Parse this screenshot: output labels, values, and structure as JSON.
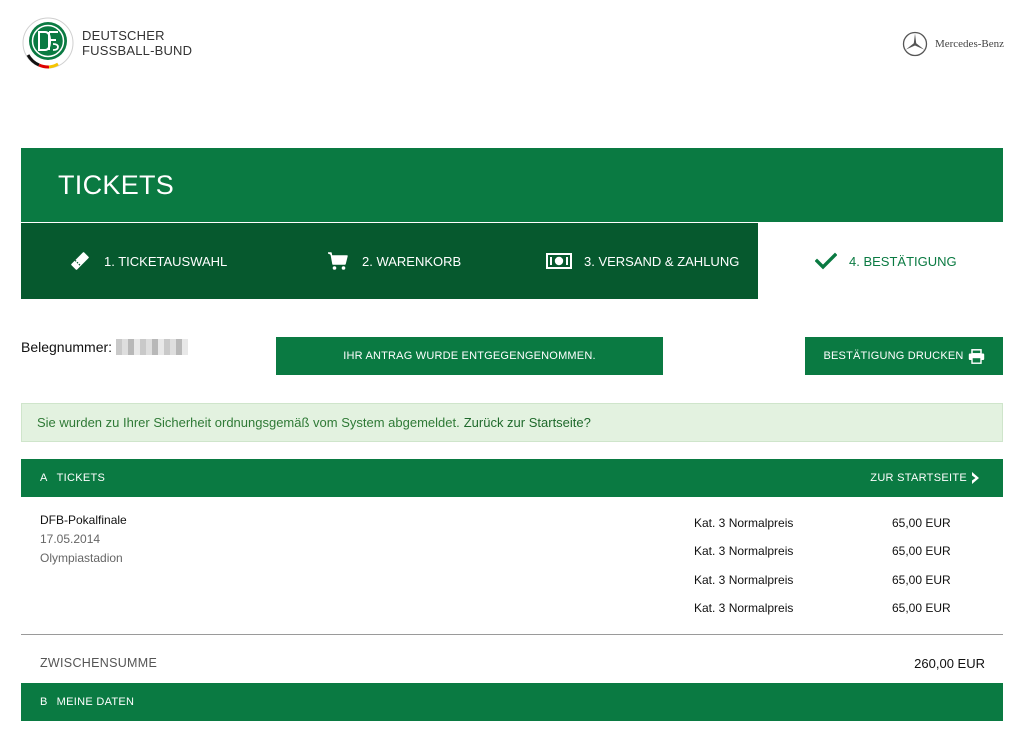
{
  "header": {
    "org_line1": "DEUTSCHER",
    "org_line2": "FUSSBALL-BUND",
    "sponsor": "Mercedes-Benz"
  },
  "banner": {
    "title": "TICKETS"
  },
  "steps": [
    {
      "label": "1. TICKETAUSWAHL",
      "icon": "ticket-icon"
    },
    {
      "label": "2. WARENKORB",
      "icon": "cart-icon"
    },
    {
      "label": "3. VERSAND & ZAHLUNG",
      "icon": "money-icon"
    },
    {
      "label": "4. BESTÄTIGUNG",
      "icon": "checkmark-icon",
      "active": true
    }
  ],
  "beleg": {
    "label": "Belegnummer:"
  },
  "buttons": {
    "status": "IHR ANTRAG WURDE ENTGEGENGENOMMEN.",
    "print": "BESTÄTIGUNG DRUCKEN"
  },
  "notice": {
    "text": "Sie wurden zu Ihrer Sicherheit ordnungsgemäß vom System abgemeldet.",
    "link": "Zurück zur Startseite?"
  },
  "section_a": {
    "letter": "A",
    "title": "TICKETS",
    "link": "ZUR STARTSEITE"
  },
  "event": {
    "name": "DFB-Pokalfinale",
    "date": "17.05.2014",
    "venue": "Olympiastadion"
  },
  "tickets": [
    {
      "category": "Kat. 3 Normalpreis",
      "price": "65,00 EUR"
    },
    {
      "category": "Kat. 3 Normalpreis",
      "price": "65,00 EUR"
    },
    {
      "category": "Kat. 3 Normalpreis",
      "price": "65,00 EUR"
    },
    {
      "category": "Kat. 3 Normalpreis",
      "price": "65,00 EUR"
    }
  ],
  "subtotal": {
    "label": "ZWISCHENSUMME",
    "value": "260,00 EUR"
  },
  "section_b": {
    "letter": "B",
    "title": "MEINE DATEN"
  },
  "colors": {
    "primary_green": "#0a7a42",
    "dark_green": "#06592e",
    "notice_bg": "#e3f2e0",
    "notice_text": "#2f7a36"
  }
}
